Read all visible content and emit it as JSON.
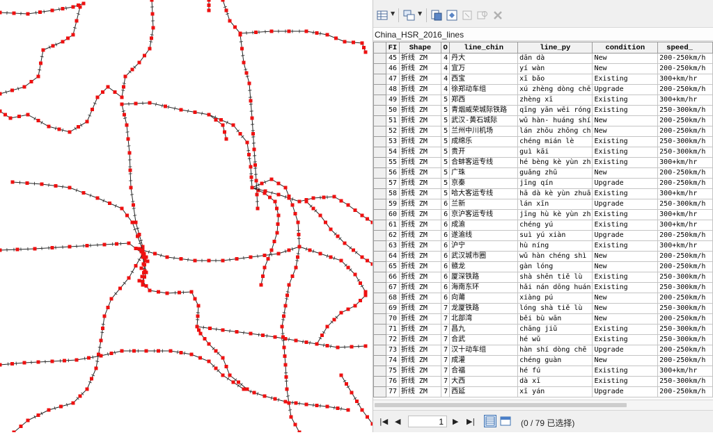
{
  "layer_title": "China_HSR_2016_lines",
  "toolbar": {
    "table_options_icon": "table-options-icon",
    "related_tables_icon": "related-tables-icon",
    "select_by_attributes_icon": "select-by-attributes-icon",
    "switch_selection_icon": "switch-selection-icon",
    "clear_selection_icon": "clear-selection-icon",
    "zoom_selected_icon": "zoom-to-selected-icon",
    "delete_selected_icon": "delete-selected-icon"
  },
  "columns": [
    "FI",
    "Shape",
    "O",
    "line_chin",
    "line_py",
    "condition",
    "speed_"
  ],
  "rows": [
    [
      "45",
      "折线 ZM",
      "4",
      "丹大",
      "dān dà",
      "New",
      "200-250km/h"
    ],
    [
      "46",
      "折线 ZM",
      "4",
      "宜万",
      "yí wàn",
      "New",
      "200-250km/h"
    ],
    [
      "47",
      "折线 ZM",
      "4",
      "西宝",
      "xī bǎo",
      "Existing",
      "300+km/hr"
    ],
    [
      "48",
      "折线 ZM",
      "4",
      "徐郑动车组",
      "xú zhèng dòng chē",
      "Upgrade",
      "200-250km/h"
    ],
    [
      "49",
      "折线 ZM",
      "5",
      "郑西",
      "zhèng xī",
      "Existing",
      "300+km/hr"
    ],
    [
      "50",
      "折线 ZM",
      "5",
      "青烟威荣城际铁路",
      "qīng yān wēi róng",
      "Existing",
      "250-300km/h"
    ],
    [
      "51",
      "折线 ZM",
      "5",
      "武汉-黄石城际",
      "wǔ hàn- huáng shí",
      "New",
      "200-250km/h"
    ],
    [
      "52",
      "折线 ZM",
      "5",
      "兰州中川机场",
      "lán zhōu zhōng ch",
      "New",
      "200-250km/h"
    ],
    [
      "53",
      "折线 ZM",
      "5",
      "成绵乐",
      "chéng mián lè",
      "Existing",
      "250-300km/h"
    ],
    [
      "54",
      "折线 ZM",
      "5",
      "贵开",
      "guì kāi",
      "Existing",
      "250-300km/h"
    ],
    [
      "55",
      "折线 ZM",
      "5",
      "合蚌客运专线",
      "hé bèng kè yùn zh",
      "Existing",
      "300+km/hr"
    ],
    [
      "56",
      "折线 ZM",
      "5",
      "广珠",
      "guǎng zhū",
      "New",
      "200-250km/h"
    ],
    [
      "57",
      "折线 ZM",
      "5",
      "京秦",
      "jīng qín",
      "Upgrade",
      "200-250km/h"
    ],
    [
      "58",
      "折线 ZM",
      "5",
      "哈大客运专线",
      "hā dà kè yùn zhuā",
      "Existing",
      "300+km/hr"
    ],
    [
      "59",
      "折线 ZM",
      "6",
      "兰新",
      "lán xīn",
      "Upgrade",
      "250-300km/h"
    ],
    [
      "60",
      "折线 ZM",
      "6",
      "京沪客运专线",
      "jīng hù kè yùn zh",
      "Existing",
      "300+km/hr"
    ],
    [
      "61",
      "折线 ZM",
      "6",
      "成渝",
      "chéng yú",
      "Existing",
      "300+km/hr"
    ],
    [
      "62",
      "折线 ZM",
      "6",
      "遂渝线",
      "suì yú xiàn",
      "Upgrade",
      "200-250km/h"
    ],
    [
      "63",
      "折线 ZM",
      "6",
      "沪宁",
      "hù níng",
      "Existing",
      "300+km/hr"
    ],
    [
      "64",
      "折线 ZM",
      "6",
      "武汉城市圈",
      "wǔ hàn chéng shì",
      "New",
      "200-250km/h"
    ],
    [
      "65",
      "折线 ZM",
      "6",
      "赣龙",
      "gàn lóng",
      "New",
      "200-250km/h"
    ],
    [
      "66",
      "折线 ZM",
      "6",
      "厦深铁路",
      "shà shēn tiě lù",
      "Existing",
      "250-300km/h"
    ],
    [
      "67",
      "折线 ZM",
      "6",
      "海南东环",
      "hǎi nán dōng huán",
      "Existing",
      "250-300km/h"
    ],
    [
      "68",
      "折线 ZM",
      "6",
      "向莆",
      "xiàng pú",
      "New",
      "200-250km/h"
    ],
    [
      "69",
      "折线 ZM",
      "7",
      "龙厦铁路",
      "lóng shà tiě lù",
      "New",
      "250-300km/h"
    ],
    [
      "70",
      "折线 ZM",
      "7",
      "北部湾",
      "běi bù wān",
      "New",
      "200-250km/h"
    ],
    [
      "71",
      "折线 ZM",
      "7",
      "昌九",
      "chāng jiǔ",
      "Existing",
      "250-300km/h"
    ],
    [
      "72",
      "折线 ZM",
      "7",
      "合武",
      "hé wǔ",
      "Existing",
      "250-300km/h"
    ],
    [
      "73",
      "折线 ZM",
      "7",
      "汉十动车组",
      "hàn shí dòng chē",
      "Upgrade",
      "200-250km/h"
    ],
    [
      "74",
      "折线 ZM",
      "7",
      "成灌",
      "chéng guàn",
      "New",
      "200-250km/h"
    ],
    [
      "75",
      "折线 ZM",
      "7",
      "合福",
      "hé fú",
      "Existing",
      "300+km/hr"
    ],
    [
      "76",
      "折线 ZM",
      "7",
      "大西",
      "dà xī",
      "Existing",
      "250-300km/h"
    ],
    [
      "77",
      "折线 ZM",
      "7",
      "西延",
      "xī yán",
      "Upgrade",
      "200-250km/h"
    ]
  ],
  "status": {
    "page_number": "1",
    "selection_text": "(0 / 79 已选择)"
  },
  "colors": {
    "line": "#222222",
    "station": "#ee1111",
    "accent": "#3a6fb0"
  }
}
